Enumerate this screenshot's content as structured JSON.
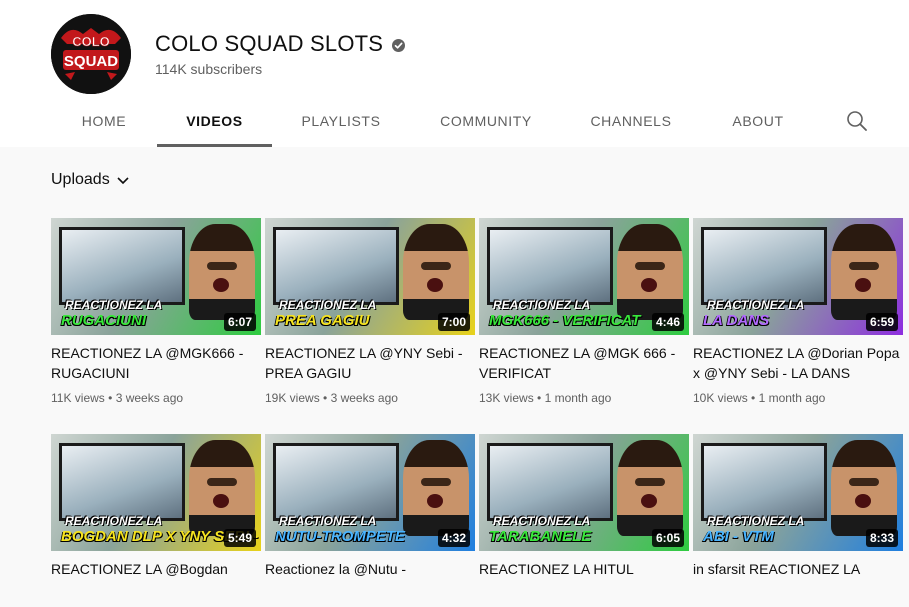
{
  "channel": {
    "name": "COLO SQUAD SLOTS",
    "subscribers": "114K subscribers",
    "avatar_text_top": "COLO",
    "avatar_text_bottom": "SQUAD"
  },
  "tabs": [
    {
      "label": "HOME"
    },
    {
      "label": "VIDEOS",
      "active": true
    },
    {
      "label": "PLAYLISTS"
    },
    {
      "label": "COMMUNITY"
    },
    {
      "label": "CHANNELS"
    },
    {
      "label": "ABOUT"
    }
  ],
  "uploads_label": "Uploads",
  "icons": {
    "search": "search-icon",
    "verified": "verified-check-icon",
    "dropdown": "chevron-down-icon"
  },
  "colors": {
    "text_primary": "#0f0f0f",
    "text_secondary": "#606060",
    "page_bg": "#f9f9f9"
  },
  "videos": [
    {
      "thumb_top": "REACTIONEZ LA",
      "thumb_bottom": "RUGACIUNI",
      "duration": "6:07",
      "title": "REACTIONEZ LA @MGK666 - RUGACIUNI",
      "views": "11K views",
      "age": "3 weeks ago",
      "accent": "#2ecc40",
      "accent_text": "#39e83b"
    },
    {
      "thumb_top": "REACTIONEZ LA",
      "thumb_bottom": "PREA GAGIU",
      "duration": "7:00",
      "title": "REACTIONEZ LA @YNY Sebi - PREA GAGIU",
      "views": "19K views",
      "age": "3 weeks ago",
      "accent": "#e8d21a",
      "accent_text": "#f5e31f"
    },
    {
      "thumb_top": "REACTIONEZ LA",
      "thumb_bottom": "MGK666 - VERIFICAT",
      "duration": "4:46",
      "title": "REACTIONEZ LA @MGK 666 - VERIFICAT",
      "views": "13K views",
      "age": "1 month ago",
      "accent": "#2ecc40",
      "accent_text": "#39e83b"
    },
    {
      "thumb_top": "REACTIONEZ LA",
      "thumb_bottom": "LA DANS",
      "duration": "6:59",
      "title": "REACTIONEZ LA @Dorian Popa x @YNY Sebi - LA DANS",
      "views": "10K views",
      "age": "1 month ago",
      "accent": "#8e2ee0",
      "accent_text": "#b26aff"
    },
    {
      "thumb_top": "REACTIONEZ LA",
      "thumb_bottom": "BOGDAN DLP X YNY SEBI - G",
      "duration": "5:49",
      "title": "REACTIONEZ LA @Bogdan",
      "views": "",
      "age": "",
      "accent": "#e8d21a",
      "accent_text": "#f5e31f"
    },
    {
      "thumb_top": "REACTIONEZ LA",
      "thumb_bottom": "NUTU-TROMPETE",
      "duration": "4:32",
      "title": "Reactionez la @Nutu -",
      "views": "",
      "age": "",
      "accent": "#1f7fe0",
      "accent_text": "#49b4ff"
    },
    {
      "thumb_top": "REACTIONEZ LA",
      "thumb_bottom": "TARABANELE",
      "duration": "6:05",
      "title": "REACTIONEZ LA HITUL",
      "views": "",
      "age": "",
      "accent": "#2ecc40",
      "accent_text": "#39e83b"
    },
    {
      "thumb_top": "REACTIONEZ LA",
      "thumb_bottom": "ABI - VTM",
      "duration": "8:33",
      "title": "in sfarsit REACTIONEZ LA",
      "views": "",
      "age": "",
      "accent": "#1f7fe0",
      "accent_text": "#49b4ff"
    }
  ]
}
